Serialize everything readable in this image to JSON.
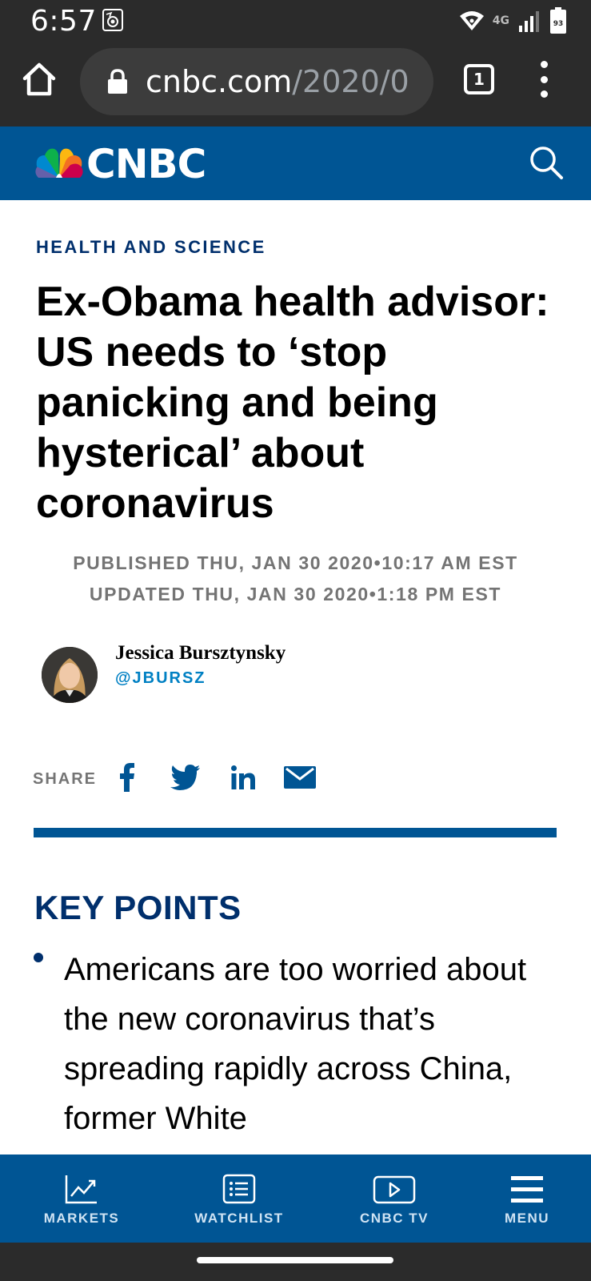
{
  "status_bar": {
    "time": "6:57",
    "network": "4G",
    "battery": "93"
  },
  "browser": {
    "url_domain": "cnbc.com",
    "url_path": "/2020/0",
    "tab_count": "1"
  },
  "site": {
    "logo_text": "CNBC",
    "brand_color": "#005594"
  },
  "article": {
    "section": "HEALTH AND SCIENCE",
    "headline": "Ex-Obama health advisor: US needs to ‘stop panicking and being hysterical’ about coronavirus",
    "published": "PUBLISHED THU, JAN 30 2020•10:17 AM EST",
    "updated": "UPDATED THU, JAN 30 2020•1:18 PM EST",
    "author_name": "Jessica Bursztynsky",
    "author_handle": "@JBURSZ",
    "share_label": "SHARE",
    "key_points_title": "KEY POINTS",
    "key_points": [
      "Americans are too worried about the new coronavirus that’s spreading rapidly across China, former White"
    ]
  },
  "bottom_nav": {
    "items": [
      {
        "label": "MARKETS",
        "icon": "chart-line-icon"
      },
      {
        "label": "WATCHLIST",
        "icon": "list-icon"
      },
      {
        "label": "CNBC TV",
        "icon": "play-icon"
      },
      {
        "label": "MENU",
        "icon": "hamburger-menu-icon"
      }
    ]
  }
}
